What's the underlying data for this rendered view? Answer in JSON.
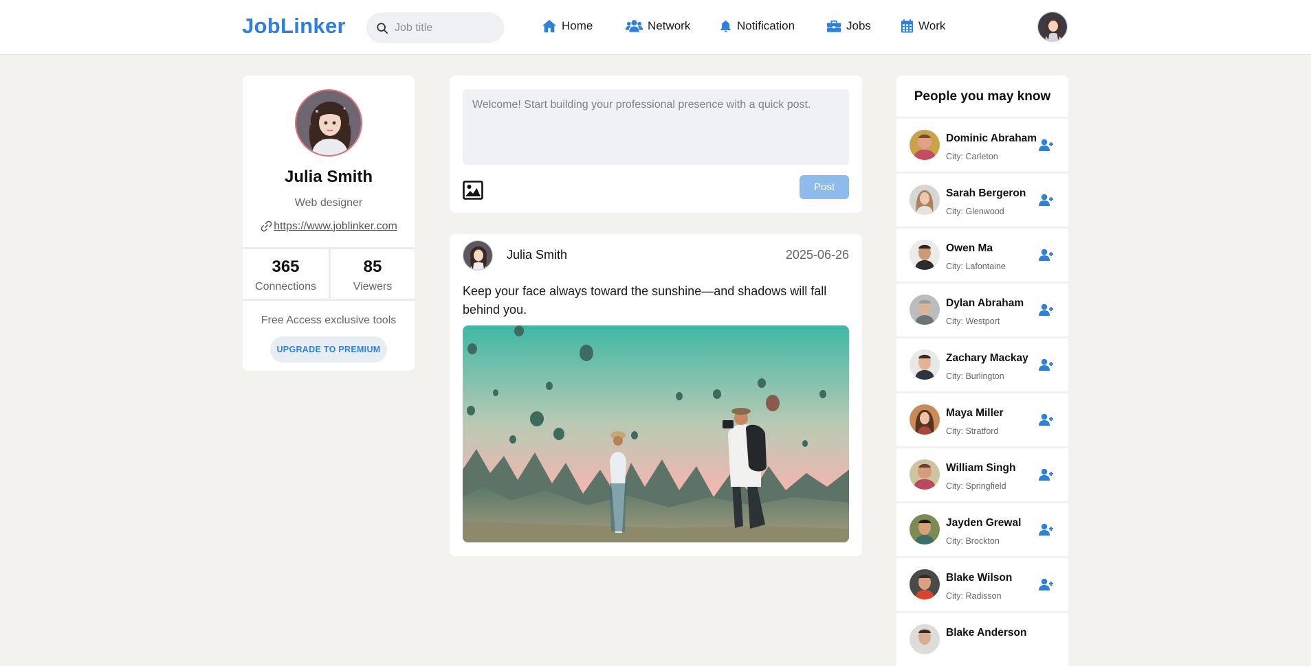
{
  "header": {
    "logo": "JobLinker",
    "search_placeholder": "Job title",
    "nav": [
      {
        "label": "Home",
        "icon": "home-icon"
      },
      {
        "label": "Network",
        "icon": "people-icon"
      },
      {
        "label": "Notification",
        "icon": "bell-icon"
      },
      {
        "label": "Jobs",
        "icon": "briefcase-icon"
      },
      {
        "label": "Work",
        "icon": "calendar-icon"
      }
    ],
    "accent_color": "#2f80d8"
  },
  "profile": {
    "name": "Julia Smith",
    "role": "Web designer",
    "link": "https://www.joblinker.com",
    "connections": "365",
    "connections_label": "Connections",
    "viewers": "85",
    "viewers_label": "Viewers",
    "free_text": "Free Access exclusive tools",
    "premium_label": "UPGRADE TO PREMIUM"
  },
  "composer": {
    "placeholder": "Welcome! Start building your professional presence with a quick post.",
    "post_label": "Post"
  },
  "post": {
    "author": "Julia Smith",
    "date": "2025-06-26",
    "text": "Keep your face always toward the sunshine—and shadows will fall behind you."
  },
  "people": {
    "title": "People you may know",
    "items": [
      {
        "name": "Dominic Abraham",
        "city": "City: Carleton"
      },
      {
        "name": "Sarah Bergeron",
        "city": "City: Glenwood"
      },
      {
        "name": "Owen Ma",
        "city": "City: Lafontaine"
      },
      {
        "name": "Dylan Abraham",
        "city": "City: Westport"
      },
      {
        "name": "Zachary Mackay",
        "city": "City: Burlington"
      },
      {
        "name": "Maya Miller",
        "city": "City: Stratford"
      },
      {
        "name": "William Singh",
        "city": "City: Springfield"
      },
      {
        "name": "Jayden Grewal",
        "city": "City: Brockton"
      },
      {
        "name": "Blake Wilson",
        "city": "City: Radisson"
      },
      {
        "name": "Blake Anderson",
        "city": ""
      }
    ]
  }
}
